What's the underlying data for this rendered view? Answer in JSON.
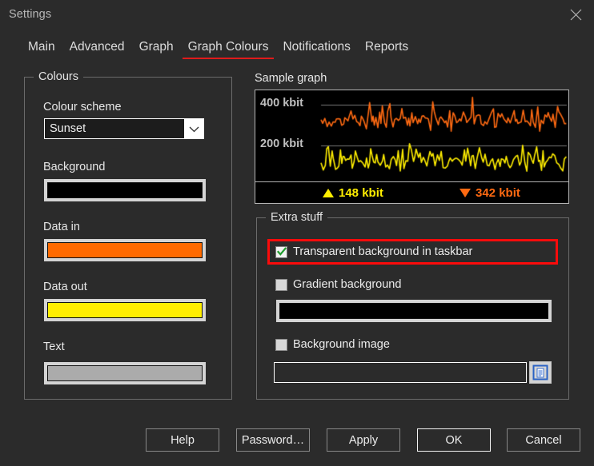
{
  "window": {
    "title": "Settings",
    "close_icon": "close-icon"
  },
  "tabs": [
    {
      "label": "Main",
      "active": false
    },
    {
      "label": "Advanced",
      "active": false
    },
    {
      "label": "Graph",
      "active": false
    },
    {
      "label": "Graph Colours",
      "active": true
    },
    {
      "label": "Notifications",
      "active": false
    },
    {
      "label": "Reports",
      "active": false
    }
  ],
  "colours_group": {
    "legend": "Colours",
    "scheme_label": "Colour scheme",
    "scheme_value": "Sunset",
    "scheme_options": [
      "Sunset"
    ],
    "swatches": [
      {
        "label": "Background",
        "colour": "#000000"
      },
      {
        "label": "Data in",
        "colour": "#ff6a00"
      },
      {
        "label": "Data out",
        "colour": "#ffee00"
      },
      {
        "label": "Text",
        "colour": "#ababab"
      }
    ]
  },
  "sample_graph": {
    "title": "Sample graph",
    "axis_labels": [
      "400 kbit",
      "200 kbit"
    ],
    "status": {
      "up_value": "148 kbit",
      "up_icon": "triangle-up-icon",
      "down_value": "342 kbit",
      "down_icon": "triangle-down-icon"
    },
    "colours": {
      "background": "#000000",
      "data_in": "#ff6a12",
      "data_out": "#ffee00",
      "text": "#bfbfbf",
      "grid": "#787878"
    }
  },
  "extra_group": {
    "legend": "Extra stuff",
    "transparent_label": "Transparent background in taskbar",
    "transparent_checked": true,
    "gradient_label": "Gradient background",
    "gradient_checked": false,
    "gradient_colour": "#000000",
    "bgimage_label": "Background image",
    "bgimage_checked": false,
    "bgimage_path": "",
    "bgimage_placeholder": "",
    "browse_icon": "document-browse-icon",
    "highlight_colour": "#fb0b0b"
  },
  "footer": {
    "buttons": [
      {
        "label": "Help",
        "default": false
      },
      {
        "label": "Password…",
        "default": false
      },
      {
        "label": "Apply",
        "default": false
      },
      {
        "label": "OK",
        "default": true
      },
      {
        "label": "Cancel",
        "default": false
      }
    ]
  },
  "chart_data": {
    "type": "line",
    "title": "Sample graph",
    "xlabel": "",
    "ylabel": "",
    "ylim": [
      0,
      500
    ],
    "yticks": [
      200,
      400
    ],
    "ytick_labels": [
      "200 kbit",
      "400 kbit"
    ],
    "grid": true,
    "legend_position": "bottom",
    "series": [
      {
        "name": "Data in",
        "colour": "#ff6a12",
        "baseline": 400,
        "annotation": "342 kbit"
      },
      {
        "name": "Data out",
        "colour": "#ffee00",
        "baseline": 200,
        "annotation": "148 kbit"
      }
    ]
  }
}
